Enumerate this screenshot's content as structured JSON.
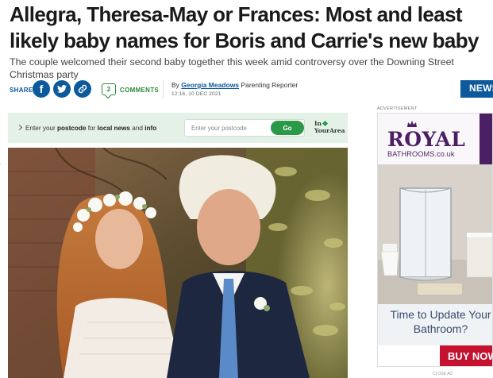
{
  "article": {
    "headline": "Allegra, Theresa-May or Frances: Most and least likely baby names for Boris and Carrie's new baby",
    "standfirst": "The couple welcomed their second baby together this week amid controversy over the Downing Street Christmas party"
  },
  "share": {
    "label": "SHARE",
    "icons": [
      "facebook-icon",
      "twitter-icon",
      "link-icon"
    ],
    "facebook_glyph": "f"
  },
  "comments": {
    "count": "2",
    "label": "COMMENTS"
  },
  "byline": {
    "prefix": "By",
    "author": "Georgia Meadows",
    "role": "Parenting Reporter",
    "date": "12:16, 10 DEC 2021"
  },
  "nav": {
    "news_tab": "NEWS"
  },
  "postcode": {
    "prompt_pre": "Enter your ",
    "prompt_bold1": "postcode",
    "prompt_mid": " for ",
    "prompt_bold2": "local news",
    "prompt_and": " and ",
    "prompt_bold3": "info",
    "placeholder": "Enter your postcode",
    "button": "Go",
    "brand_line1": "In",
    "brand_line2": "YourArea"
  },
  "advert": {
    "label": "ADVERTISEMENT",
    "logo_main": "ROYAL",
    "logo_sub": "BATHROOMS.co.uk",
    "headline": "Time to Update Your Bathroom?",
    "cta": "BUY NOW",
    "footer": "CLOSE AD",
    "colors": {
      "brand": "#4a1f63",
      "cta": "#c41230",
      "headline": "#3a4a6a"
    }
  },
  "colors": {
    "link_blue": "#0c57a0",
    "comments_green": "#2a8a3c",
    "postcode_bg": "#e4f1e6",
    "go_green": "#2a9a48"
  }
}
